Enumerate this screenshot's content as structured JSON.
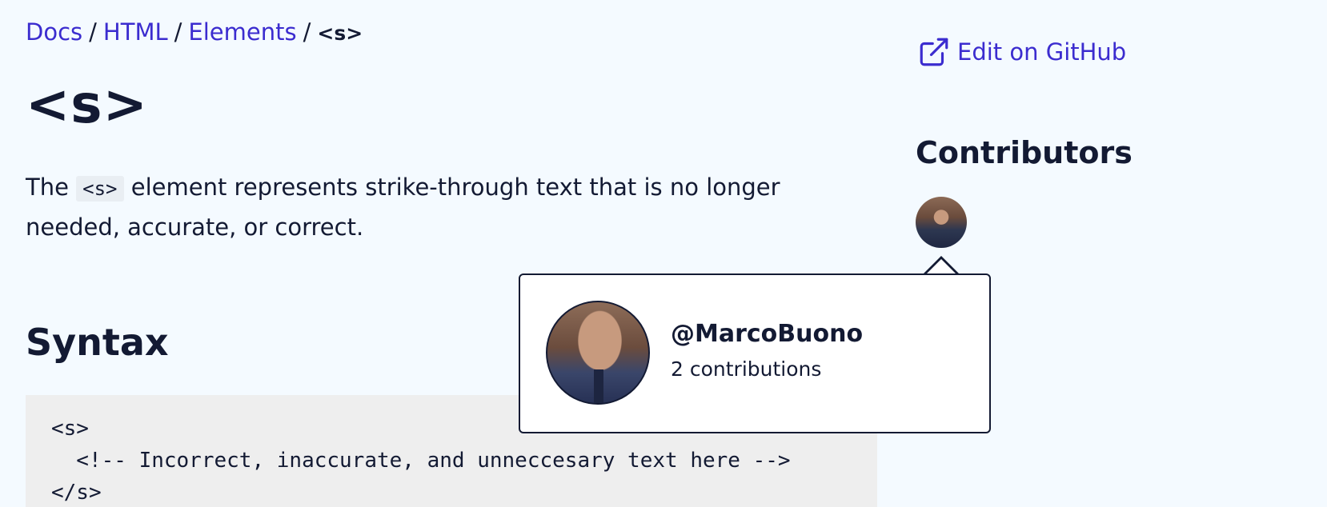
{
  "breadcrumb": {
    "items": [
      "Docs",
      "HTML",
      "Elements"
    ],
    "separator": "/",
    "current": "<s>"
  },
  "page": {
    "title": "<s>",
    "description_before": "The ",
    "description_code": "<s>",
    "description_after": " element represents strike-through text that is no longer needed, accurate, or correct."
  },
  "syntax": {
    "heading": "Syntax",
    "code_lines": [
      "<s>",
      "  <!-- Incorrect, inaccurate, and unneccesary text here -->",
      "</s>"
    ]
  },
  "sidebar": {
    "edit_link": "Edit on GitHub",
    "edit_icon": "external-link-icon",
    "contributors_heading": "Contributors"
  },
  "popover": {
    "username": "@MarcoBuono",
    "contributions": "2 contributions"
  },
  "colors": {
    "background": "#f4faff",
    "link": "#3b2ccf",
    "text": "#131a33",
    "code_background": "#eeeeee"
  }
}
